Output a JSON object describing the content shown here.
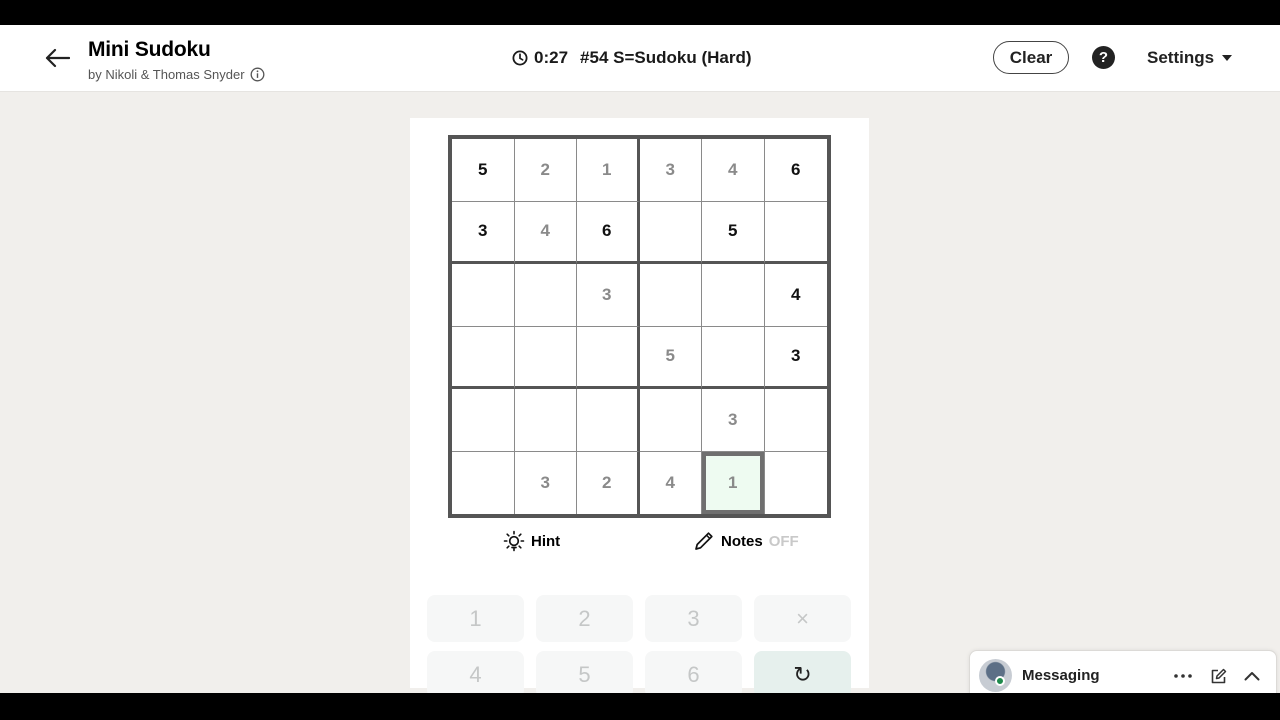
{
  "header": {
    "title": "Mini Sudoku",
    "byline": "by Nikoli & Thomas Snyder",
    "timer": "0:27",
    "puzzle_label": "#54 S=Sudoku (Hard)",
    "clear_label": "Clear",
    "help_label": "?",
    "settings_label": "Settings"
  },
  "grid": {
    "rows": [
      [
        {
          "v": "5",
          "t": "given"
        },
        {
          "v": "2",
          "t": "user"
        },
        {
          "v": "1",
          "t": "user"
        },
        {
          "v": "3",
          "t": "user"
        },
        {
          "v": "4",
          "t": "user"
        },
        {
          "v": "6",
          "t": "given"
        }
      ],
      [
        {
          "v": "3",
          "t": "given"
        },
        {
          "v": "4",
          "t": "user"
        },
        {
          "v": "6",
          "t": "given"
        },
        {
          "v": "",
          "t": "empty"
        },
        {
          "v": "5",
          "t": "given"
        },
        {
          "v": "",
          "t": "empty"
        }
      ],
      [
        {
          "v": "",
          "t": "empty"
        },
        {
          "v": "",
          "t": "empty"
        },
        {
          "v": "3",
          "t": "user"
        },
        {
          "v": "",
          "t": "empty"
        },
        {
          "v": "",
          "t": "empty"
        },
        {
          "v": "4",
          "t": "given"
        }
      ],
      [
        {
          "v": "",
          "t": "empty"
        },
        {
          "v": "",
          "t": "empty"
        },
        {
          "v": "",
          "t": "empty"
        },
        {
          "v": "5",
          "t": "user"
        },
        {
          "v": "",
          "t": "empty"
        },
        {
          "v": "3",
          "t": "given"
        }
      ],
      [
        {
          "v": "",
          "t": "empty"
        },
        {
          "v": "",
          "t": "empty"
        },
        {
          "v": "",
          "t": "empty"
        },
        {
          "v": "",
          "t": "empty"
        },
        {
          "v": "3",
          "t": "user"
        },
        {
          "v": "",
          "t": "empty"
        }
      ],
      [
        {
          "v": "",
          "t": "empty"
        },
        {
          "v": "3",
          "t": "user"
        },
        {
          "v": "2",
          "t": "user"
        },
        {
          "v": "4",
          "t": "user"
        },
        {
          "v": "1",
          "t": "user"
        },
        {
          "v": "",
          "t": "empty"
        }
      ]
    ],
    "selected_row": 5,
    "selected_col": 4
  },
  "tools": {
    "hint_label": "Hint",
    "notes_label": "Notes",
    "notes_state": "OFF"
  },
  "keypad": {
    "keys": [
      "1",
      "2",
      "3",
      "×",
      "4",
      "5",
      "6",
      "↻"
    ]
  },
  "messaging": {
    "label": "Messaging"
  },
  "colors": {
    "selected_cell_bg": "#eefbf1",
    "undo_key_bg": "#e6f0ed",
    "presence": "#1e8a4c"
  }
}
